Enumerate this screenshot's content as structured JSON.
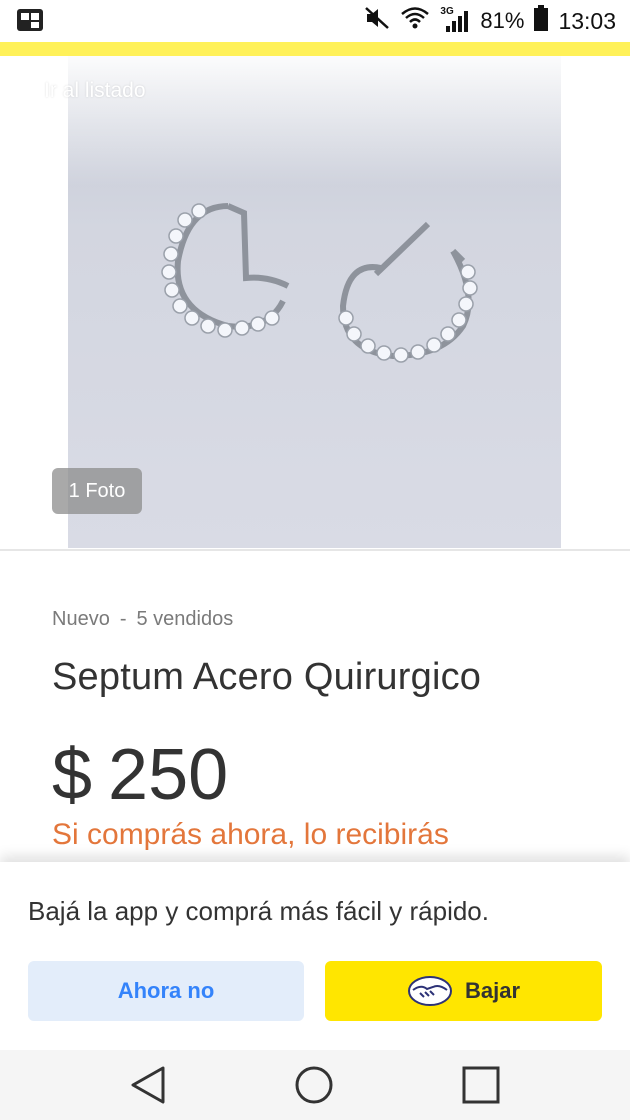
{
  "status_bar": {
    "battery": "81%",
    "time": "13:03",
    "network_type": "3G"
  },
  "header": {
    "back_label": "Ir al listado"
  },
  "gallery": {
    "photo_count_label": "1 Foto"
  },
  "item": {
    "condition": "Nuevo",
    "separator": "-",
    "sold": "5 vendidos",
    "title": "Septum Acero Quirurgico",
    "currency": "$",
    "price": "250",
    "shipping_text": "Si comprás ahora, lo recibirás"
  },
  "app_banner": {
    "message": "Bajá la app y comprá más fácil y rápido.",
    "secondary_label": "Ahora no",
    "primary_label": "Bajar"
  },
  "colors": {
    "brand_yellow": "#fff159",
    "button_yellow": "#ffe600",
    "link_blue": "#3483fa",
    "shipping_orange": "#e3763b"
  },
  "icons": {
    "status_left": "app-notification-icon",
    "mute": "mute-icon",
    "wifi": "wifi-icon",
    "signal": "signal-icon",
    "battery": "battery-icon",
    "back": "chevron-left-icon",
    "brand": "mercadolibre-handshake-icon",
    "nav_back": "triangle-back-icon",
    "nav_home": "circle-home-icon",
    "nav_recents": "square-recents-icon"
  }
}
